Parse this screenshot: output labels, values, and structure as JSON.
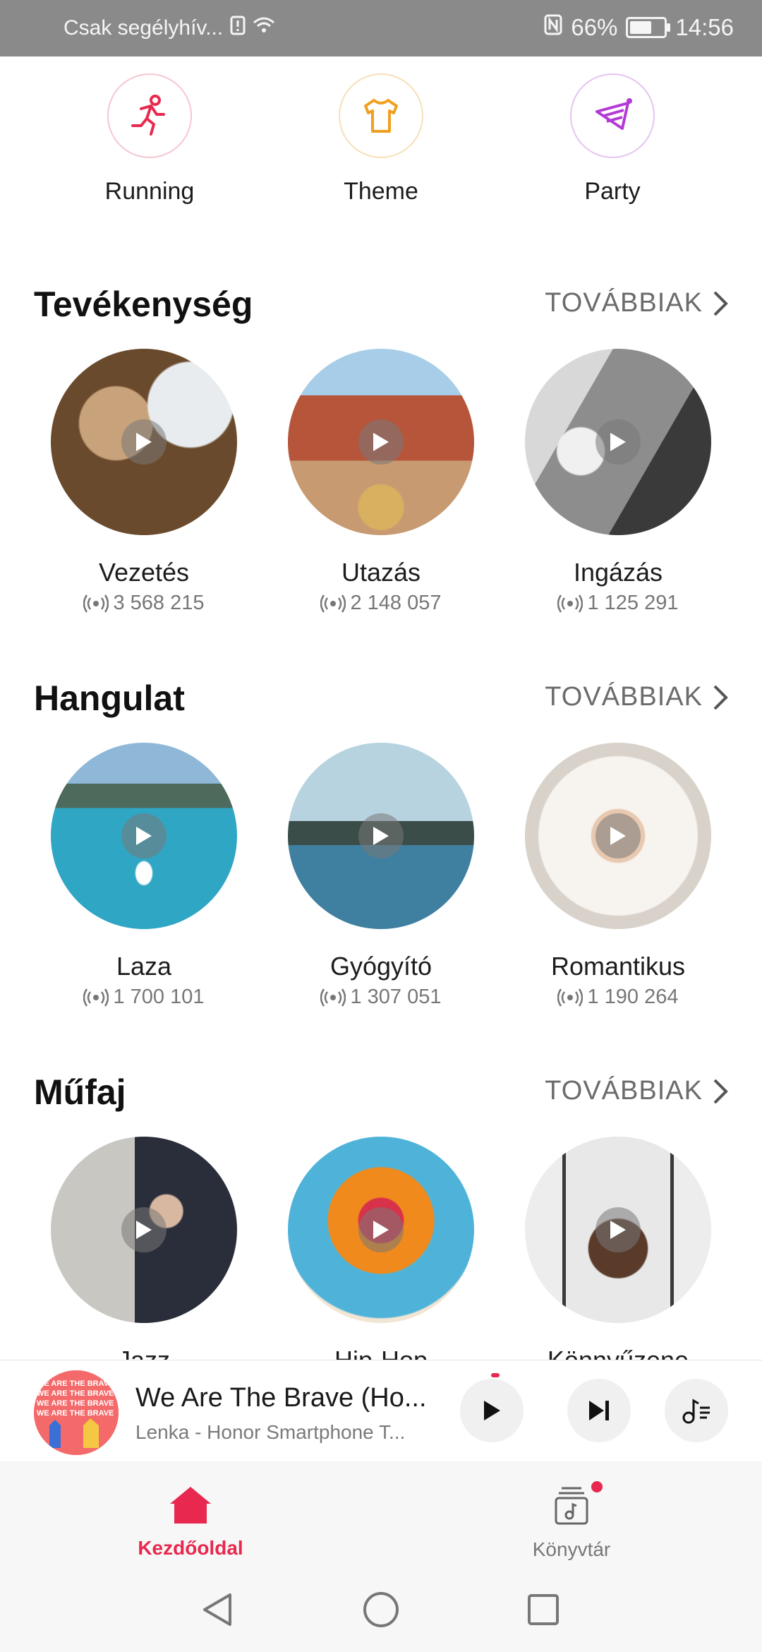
{
  "status_bar": {
    "carrier": "Csak segélyhív...",
    "battery": "66%",
    "battery_level": 0.66,
    "time": "14:56"
  },
  "top_categories": [
    {
      "label": "Running",
      "icon": "running-icon",
      "color": "#e8284f"
    },
    {
      "label": "Theme",
      "icon": "tshirt-icon",
      "color": "#f0a020"
    },
    {
      "label": "Party",
      "icon": "party-hat-icon",
      "color": "#b43ad6"
    }
  ],
  "sections": [
    {
      "title": "Tevékenység",
      "more": "TOVÁBBIAK",
      "items": [
        {
          "title": "Vezetés",
          "count": "3 568 215"
        },
        {
          "title": "Utazás",
          "count": "2 148 057"
        },
        {
          "title": "Ingázás",
          "count": "1 125 291"
        }
      ]
    },
    {
      "title": "Hangulat",
      "more": "TOVÁBBIAK",
      "items": [
        {
          "title": "Laza",
          "count": "1 700 101"
        },
        {
          "title": "Gyógyító",
          "count": "1 307 051"
        },
        {
          "title": "Romantikus",
          "count": "1 190 264"
        }
      ]
    },
    {
      "title": "Műfaj",
      "more": "TOVÁBBIAK",
      "items": [
        {
          "title": "Jazz",
          "count": ""
        },
        {
          "title": "Hip-Hop",
          "count": ""
        },
        {
          "title": "Könnyűzene",
          "count": ""
        }
      ]
    }
  ],
  "player": {
    "title": "We Are The Brave (Ho...",
    "subtitle": "Lenka - Honor Smartphone T...",
    "art_text": "WE ARE THE BRAVE"
  },
  "bottom_nav": [
    {
      "label": "Kezdőoldal",
      "active": true
    },
    {
      "label": "Könyvtár",
      "active": false
    }
  ],
  "colors": {
    "accent": "#e8284f"
  }
}
